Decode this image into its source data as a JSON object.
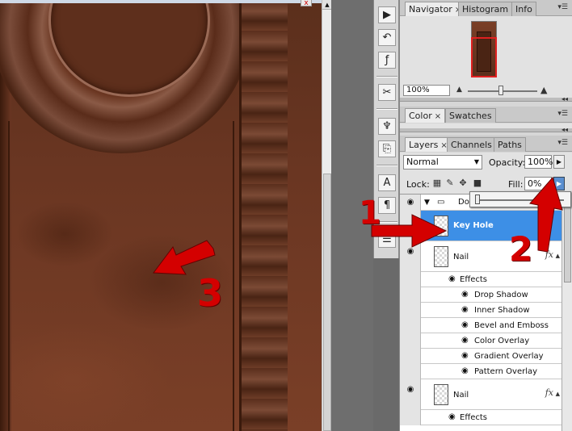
{
  "document": {
    "close_glyph": "x"
  },
  "navigator": {
    "tabs": [
      "Navigator",
      "Histogram",
      "Info"
    ],
    "zoom_value": "100%",
    "menu_icon": "panel-menu-icon"
  },
  "color_panel": {
    "tabs": [
      "Color",
      "Swatches"
    ]
  },
  "layers": {
    "tabs": [
      "Layers",
      "Channels",
      "Paths"
    ],
    "blend_mode": "Normal",
    "opacity_label": "Opacity:",
    "opacity_value": "100%",
    "lock_label": "Lock:",
    "fill_label": "Fill:",
    "fill_value": "0%",
    "group_name": "Do",
    "selected_layer": "Key Hole",
    "nail_layer_1": {
      "name": "Nail",
      "fx": "fx",
      "effects_label": "Effects",
      "effects": [
        "Drop Shadow",
        "Inner Shadow",
        "Bevel and Emboss",
        "Color Overlay",
        "Gradient Overlay",
        "Pattern Overlay"
      ]
    },
    "nail_layer_2": {
      "name": "Nail",
      "fx": "fx",
      "effects_label": "Effects"
    }
  },
  "annotations": {
    "one": "1",
    "two": "2",
    "three": "3",
    "color": "#d40000"
  },
  "colors": {
    "selection": "#3d8fe6",
    "accent_red": "#d40000"
  }
}
